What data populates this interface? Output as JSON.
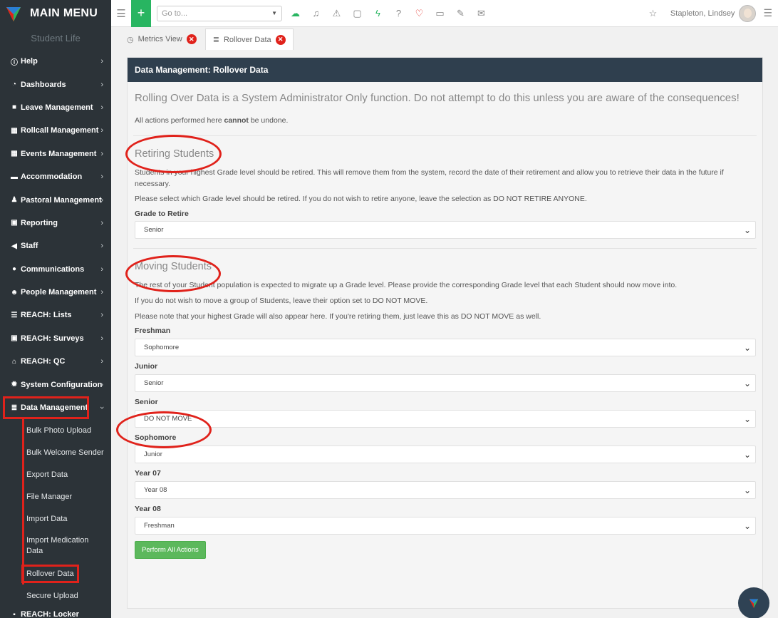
{
  "sidebar": {
    "title": "MAIN MENU",
    "subtitle": "Student Life",
    "items": [
      {
        "label": "Help",
        "icon": "info-icon"
      },
      {
        "label": "Dashboards",
        "icon": "dashboard-icon"
      },
      {
        "label": "Leave Management",
        "icon": "suitcase-icon"
      },
      {
        "label": "Rollcall Management",
        "icon": "table-icon"
      },
      {
        "label": "Events Management",
        "icon": "calendar-icon"
      },
      {
        "label": "Accommodation",
        "icon": "bed-icon"
      },
      {
        "label": "Pastoral Management",
        "icon": "pastoral-icon"
      },
      {
        "label": "Reporting",
        "icon": "report-icon"
      },
      {
        "label": "Staff",
        "icon": "megaphone-icon"
      },
      {
        "label": "Communications",
        "icon": "chat-icon"
      },
      {
        "label": "People Management",
        "icon": "people-icon"
      },
      {
        "label": "REACH: Lists",
        "icon": "list-icon"
      },
      {
        "label": "REACH: Surveys",
        "icon": "survey-icon"
      },
      {
        "label": "REACH: QC",
        "icon": "bank-icon"
      },
      {
        "label": "System Configuration",
        "icon": "cog-icon"
      },
      {
        "label": "Data Management",
        "icon": "database-icon"
      }
    ],
    "sub_items": [
      "Bulk Photo Upload",
      "Bulk Welcome Sender",
      "Export Data",
      "File Manager",
      "Import Data",
      "Import Medication Data",
      "Rollover Data",
      "Secure Upload"
    ],
    "cut_off_item": "REACH: Locker"
  },
  "topbar": {
    "goto_placeholder": "Go to...",
    "user_name": "Stapleton, Lindsey",
    "icons": [
      "cloud-icon",
      "bell-icon",
      "warning-icon",
      "calendar-icon",
      "lightning-icon",
      "help-icon",
      "heartbeat-icon",
      "note-icon",
      "magic-icon",
      "chat-icon"
    ]
  },
  "tabs": [
    {
      "label": "Metrics View",
      "icon": "gauge-icon"
    },
    {
      "label": "Rollover Data",
      "icon": "database-icon"
    }
  ],
  "panel": {
    "title": "Data Management: Rollover Data",
    "lead": "Rolling Over Data is a System Administrator Only function. Do not attempt to do this unless you are aware of the consequences!",
    "undo_pre": "All actions performed here ",
    "undo_bold": "cannot",
    "undo_post": " be undone.",
    "retiring": {
      "heading": "Retiring Students",
      "p1": "Students in your highest Grade level should be retired. This will remove them from the system, record the date of their retirement and allow you to retrieve their data in the future if necessary.",
      "p2": "Please select which Grade level should be retired. If you do not wish to retire anyone, leave the selection as DO NOT RETIRE ANYONE.",
      "field_label": "Grade to Retire",
      "field_value": "Senior"
    },
    "moving": {
      "heading": "Moving Students",
      "p1": "The rest of your Student population is expected to migrate up a Grade level. Please provide the corresponding Grade level that each Student should now move into.",
      "p2": "If you do not wish to move a group of Students, leave their option set to DO NOT MOVE.",
      "p3": "Please note that your highest Grade will also appear here. If you're retiring them, just leave this as DO NOT MOVE as well.",
      "fields": [
        {
          "label": "Freshman",
          "value": "Sophomore"
        },
        {
          "label": "Junior",
          "value": "Senior"
        },
        {
          "label": "Senior",
          "value": "DO NOT MOVE"
        },
        {
          "label": "Sophomore",
          "value": "Junior"
        },
        {
          "label": "Year 07",
          "value": "Year 08"
        },
        {
          "label": "Year 08",
          "value": "Freshman"
        }
      ]
    },
    "action_button": "Perform All Actions"
  },
  "colors": {
    "sidebar_bg": "#2c3338",
    "header_bg": "#2f3f4e",
    "accent_green": "#28b561",
    "button_green": "#5cb85c",
    "annotation_red": "#e0221b"
  }
}
